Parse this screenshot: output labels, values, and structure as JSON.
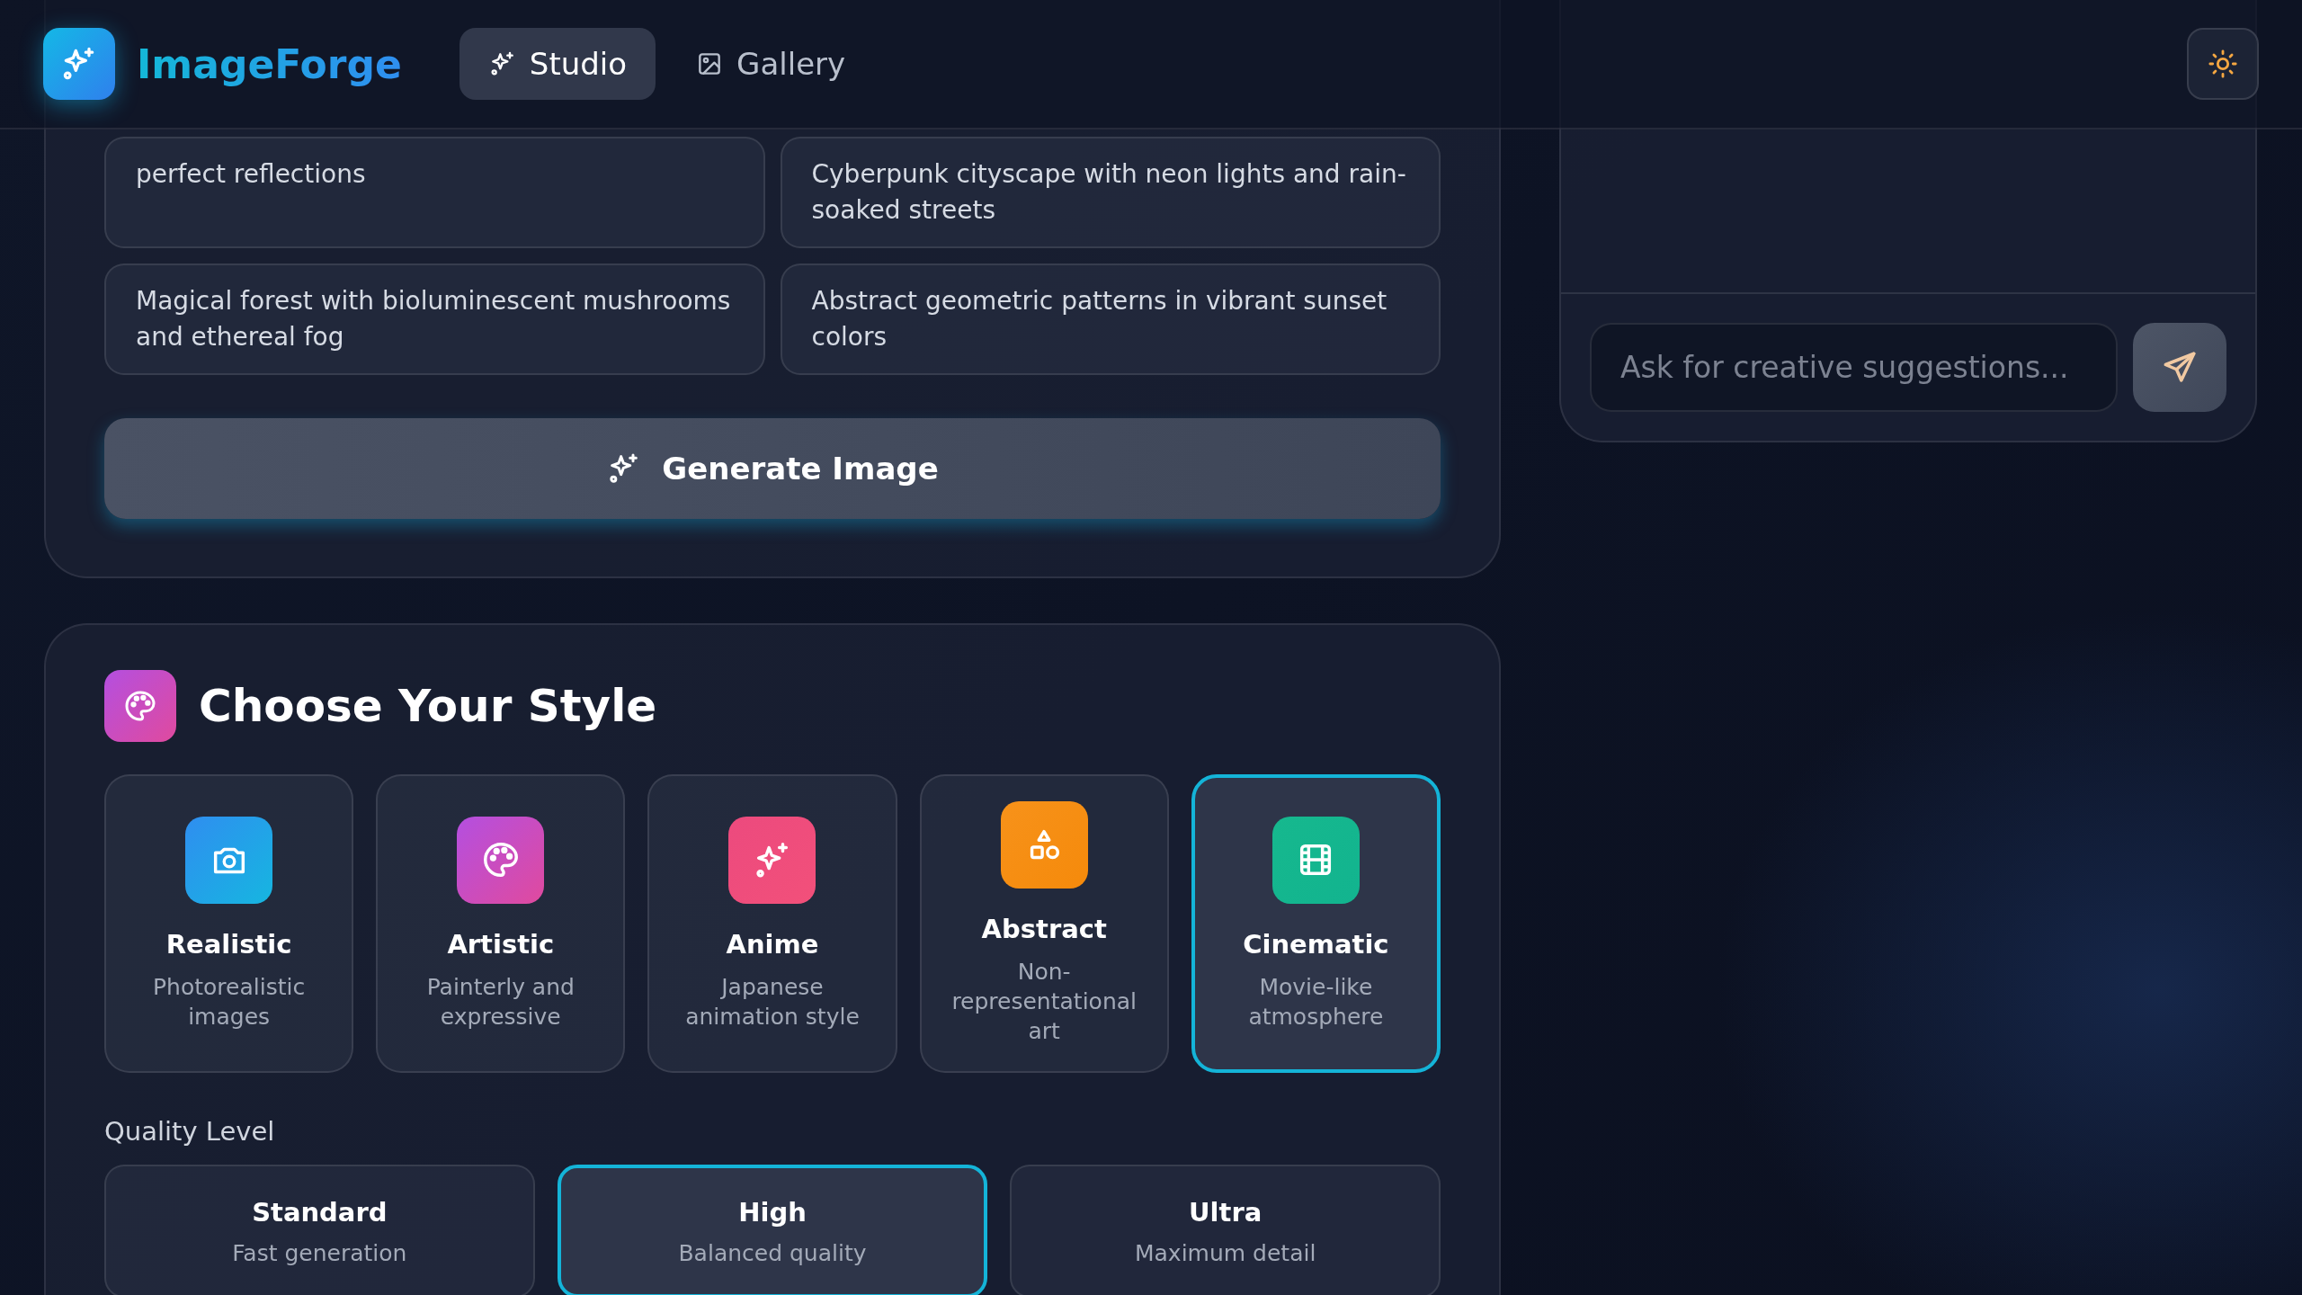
{
  "header": {
    "brand": "ImageForge",
    "nav": [
      {
        "label": "Studio",
        "selected": true
      },
      {
        "label": "Gallery",
        "selected": false
      }
    ]
  },
  "prompt_suggestions": [
    "perfect reflections",
    "Cyberpunk cityscape with neon lights and rain-soaked streets",
    "Magical forest with bioluminescent mushrooms and ethereal fog",
    "Abstract geometric patterns in vibrant sunset colors"
  ],
  "generate_button": "Generate Image",
  "style_section": {
    "title": "Choose Your Style",
    "styles": [
      {
        "name": "Realistic",
        "description": "Photorealistic images",
        "selected": false
      },
      {
        "name": "Artistic",
        "description": "Painterly and expressive",
        "selected": false
      },
      {
        "name": "Anime",
        "description": "Japanese animation style",
        "selected": false
      },
      {
        "name": "Abstract",
        "description": "Non-representational art",
        "selected": false
      },
      {
        "name": "Cinematic",
        "description": "Movie-like atmosphere",
        "selected": true
      }
    ]
  },
  "quality": {
    "label": "Quality Level",
    "options": [
      {
        "name": "Standard",
        "description": "Fast generation",
        "selected": false
      },
      {
        "name": "High",
        "description": "Balanced quality",
        "selected": true
      },
      {
        "name": "Ultra",
        "description": "Maximum detail",
        "selected": false
      }
    ]
  },
  "assistant": {
    "placeholder": "Ask for creative suggestions..."
  }
}
